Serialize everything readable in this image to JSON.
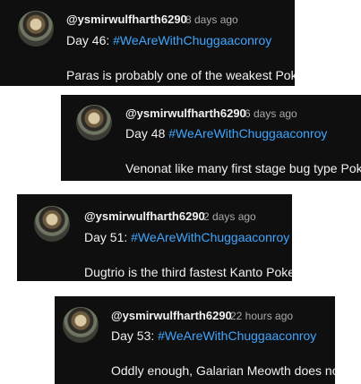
{
  "comments": [
    {
      "handle": "@ysmirwulfharth6290",
      "time": "8 days ago",
      "day_label": "Day 46:",
      "hashtag": "#WeAreWithChuggaaconroy",
      "body_text": "Paras is probably one of the weakest Pok"
    },
    {
      "handle": "@ysmirwulfharth6290",
      "time": "6 days ago",
      "day_label": "Day 48",
      "hashtag": "#WeAreWithChuggaaconroy",
      "body_text": "Venonat like many first stage bug type Pok"
    },
    {
      "handle": "@ysmirwulfharth6290",
      "time": "2 days ago",
      "day_label": "Day 51:",
      "hashtag": "#WeAreWithChuggaaconroy",
      "body_text": "Dugtrio is the third fastest Kanto Poke"
    },
    {
      "handle": "@ysmirwulfharth6290",
      "time": "22 hours ago",
      "day_label": "Day 53:",
      "hashtag": "#WeAreWithChuggaaconroy",
      "body_text": "Oddly enough, Galarian Meowth does no"
    }
  ],
  "colors": {
    "background": "#0f0f0f",
    "hashtag": "#3ea6ff",
    "secondary_text": "#aaaaaa",
    "text": "#f1f1f1"
  }
}
